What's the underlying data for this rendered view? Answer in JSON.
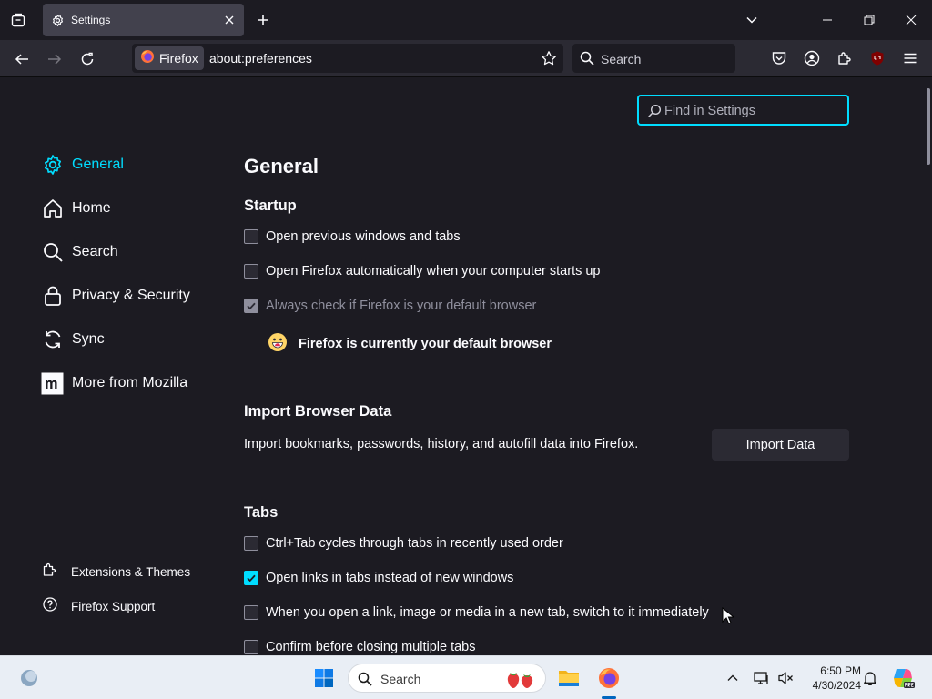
{
  "tab": {
    "title": "Settings"
  },
  "urlbar": {
    "identity_label": "Firefox",
    "url": "about:preferences"
  },
  "searchbar": {
    "placeholder": "Search"
  },
  "find": {
    "placeholder": "Find in Settings"
  },
  "sidebar": {
    "categories": [
      {
        "label": "General",
        "icon": "gear-icon",
        "selected": true
      },
      {
        "label": "Home",
        "icon": "home-icon"
      },
      {
        "label": "Search",
        "icon": "search-icon"
      },
      {
        "label": "Privacy & Security",
        "icon": "lock-icon"
      },
      {
        "label": "Sync",
        "icon": "sync-icon"
      },
      {
        "label": "More from Mozilla",
        "icon": "mozilla-icon"
      }
    ],
    "footer": [
      {
        "label": "Extensions & Themes",
        "icon": "puzzle-icon"
      },
      {
        "label": "Firefox Support",
        "icon": "help-icon"
      }
    ]
  },
  "main": {
    "title": "General",
    "startup": {
      "heading": "Startup",
      "options": [
        {
          "label": "Open previous windows and tabs",
          "checked": false,
          "disabled": false
        },
        {
          "label": "Open Firefox automatically when your computer starts up",
          "checked": false,
          "disabled": false
        },
        {
          "label": "Always check if Firefox is your default browser",
          "checked": true,
          "disabled": true
        }
      ],
      "default_status": "Firefox is currently your default browser"
    },
    "import": {
      "heading": "Import Browser Data",
      "description": "Import bookmarks, passwords, history, and autofill data into Firefox.",
      "button": "Import Data"
    },
    "tabs": {
      "heading": "Tabs",
      "options": [
        {
          "label": "Ctrl+Tab cycles through tabs in recently used order",
          "checked": false
        },
        {
          "label": "Open links in tabs instead of new windows",
          "checked": true
        },
        {
          "label": "When you open a link, image or media in a new tab, switch to it immediately",
          "checked": false
        },
        {
          "label": "Confirm before closing multiple tabs",
          "checked": false
        }
      ]
    }
  },
  "taskbar": {
    "search_placeholder": "Search",
    "time": "6:50 PM",
    "date": "4/30/2024"
  },
  "colors": {
    "accent": "#00ddff",
    "background": "#1c1b22",
    "toolbar": "#2b2a33"
  }
}
